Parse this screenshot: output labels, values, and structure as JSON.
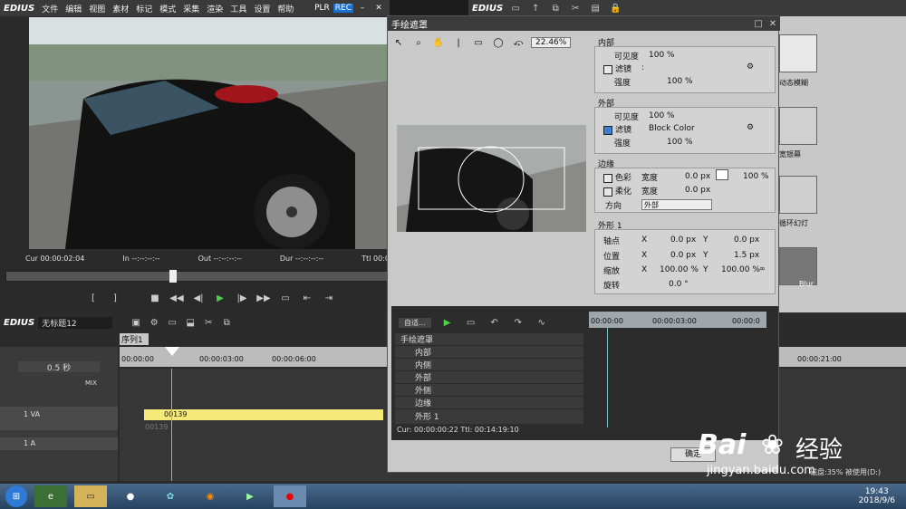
{
  "app": {
    "brand": "EDIUS",
    "menus": [
      "文件",
      "编辑",
      "视图",
      "素材",
      "标记",
      "模式",
      "采集",
      "渲染",
      "工具",
      "设置",
      "帮助"
    ],
    "plr": "PLR",
    "rec": "REC"
  },
  "player": {
    "timecodes": {
      "cur": "Cur 00:00:02:04",
      "in": "In --:--:--:--",
      "out": "Out --:--:--:--",
      "dur": "Dur --:--:--:--",
      "ttl": "Ttl 00:0"
    }
  },
  "bin": {
    "brand": "EDIUS",
    "items": [
      {
        "label": "动态模糊"
      },
      {
        "label": "宽银幕"
      },
      {
        "label": "循环幻灯"
      },
      {
        "label": "Blur"
      }
    ]
  },
  "dialog": {
    "title": "手绘遮罩",
    "zoom": "22.46%",
    "inner": {
      "header": "内部",
      "visibility_label": "可见度",
      "visibility_value": "100 %",
      "filter_label": "滤镜",
      "filter_value": ":",
      "strength_label": "强度",
      "strength_value": "100 %"
    },
    "outer": {
      "header": "外部",
      "visibility_label": "可见度",
      "visibility_value": "100 %",
      "filter_label": "滤镜",
      "filter_value": "Block Color",
      "strength_label": "强度",
      "strength_value": "100 %"
    },
    "edge": {
      "header": "边缘",
      "color_label": "色彩",
      "width_label": "宽度",
      "color_width": "0.0 px",
      "color_pct": "100 %",
      "soft_label": "柔化",
      "soft_width": "0.0 px",
      "dir_label": "方向",
      "dir_value": "外部"
    },
    "shape": {
      "header": "外形 1",
      "pivot_label": "轴点",
      "pos_label": "位置",
      "scale_label": "缩放",
      "rot_label": "旋转",
      "x": "X",
      "y": "Y",
      "pivot_x": "0.0 px",
      "pivot_y": "0.0 px",
      "pos_x": "0.0 px",
      "pos_y": "1.5 px",
      "scale_x": "100.00 %",
      "scale_y": "100.00 %",
      "rot": "0.0 °"
    },
    "tree": {
      "dropdown": "自适...",
      "items": [
        "手绘遮罩",
        "内部",
        "内侧",
        "外部",
        "外侧",
        "边缘",
        "外形 1"
      ]
    },
    "ruler": [
      "00:00:00",
      "00:00:03:00",
      "00:00:0"
    ],
    "status": "Cur: 00:00:00:22   Ttl: 00:14:19:10",
    "ok_label": "确定"
  },
  "timeline": {
    "brand": "EDIUS",
    "project": "无标题12",
    "sequence_tab": "序列1",
    "scale": "0.5 秒",
    "ruler": [
      "00:00:00",
      "00:00:03:00",
      "00:00:06:00",
      "00:00:21:00"
    ],
    "tracks": {
      "mix": "MIX",
      "va": "1 VA",
      "a": "1 A"
    },
    "clip_name": "00139",
    "clip_sub": "00139",
    "disk": "磁盘:35% 被使用(D:)"
  },
  "taskbar": {
    "time": "19:43",
    "date": "2018/9/6"
  },
  "watermark": {
    "brand": "Bai",
    "brand2": "经验",
    "url": "jingyan.baidu.com"
  },
  "colors": {
    "accent_green": "#4ed24e",
    "clip_yellow": "#f5e97a",
    "timeline_cursor": "#79c0c0"
  }
}
